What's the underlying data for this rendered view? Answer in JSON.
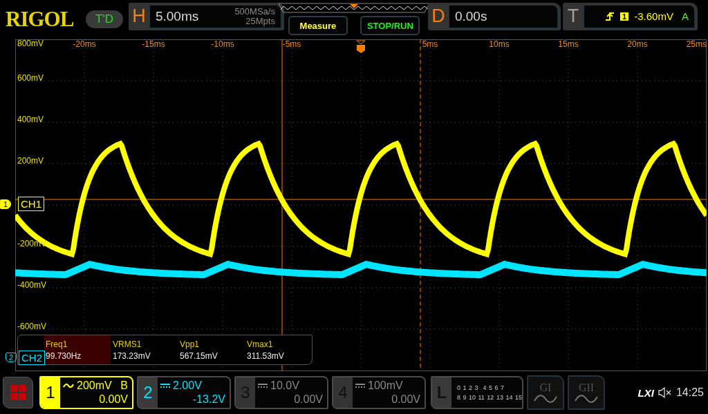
{
  "brand": "RIGOL",
  "trigger_status": "T'D",
  "horizontal": {
    "label": "H",
    "timebase": "5.00ms",
    "sample_rate": "500MSa/s",
    "memory_depth": "25Mpts"
  },
  "buttons": [
    {
      "label": "Measure",
      "kind": "measure"
    },
    {
      "label": "STOP/RUN",
      "kind": "run"
    }
  ],
  "delay": {
    "label": "D",
    "value": "0.00s"
  },
  "trigger": {
    "label": "T",
    "source": "1",
    "level": "-3.60mV",
    "mode": "A"
  },
  "x_axis_labels": [
    "-20ms",
    "-15ms",
    "-10ms",
    "-5ms",
    "5ms",
    "10ms",
    "15ms",
    "20ms",
    "25ms"
  ],
  "y_axis_labels": [
    "800mV",
    "600mV",
    "400mV",
    "200mV",
    "-200mV",
    "-400mV",
    "-600mV"
  ],
  "channel_markers": [
    {
      "number": "1",
      "label": "CH1",
      "color": "#ffff00"
    },
    {
      "number": "2",
      "label": "CH2",
      "color": "#00e5ff"
    }
  ],
  "measurements": [
    {
      "name": "Freq1",
      "value": "99.730Hz",
      "selected": true
    },
    {
      "name": "VRMS1",
      "value": "173.23mV",
      "selected": false
    },
    {
      "name": "Vpp1",
      "value": "567.15mV",
      "selected": false
    },
    {
      "name": "Vmax1",
      "value": "311.53mV",
      "selected": false
    }
  ],
  "channels": [
    {
      "number": "1",
      "scale": "200mV",
      "offset": "0.00V",
      "ac_coupled": true,
      "bandwidth_limit": "B",
      "selected": true,
      "enabled": true,
      "color": "#ffff00"
    },
    {
      "number": "2",
      "scale": "2.00V",
      "offset": "-13.2V",
      "ac_coupled": false,
      "selected": false,
      "enabled": true,
      "color": "#00e5ff"
    },
    {
      "number": "3",
      "scale": "10.0V",
      "offset": "0.00V",
      "ac_coupled": false,
      "selected": false,
      "enabled": false,
      "color": "#8a8a8a"
    },
    {
      "number": "4",
      "scale": "100mV",
      "offset": "0.00V",
      "ac_coupled": false,
      "selected": false,
      "enabled": false,
      "color": "#8a8a8a"
    }
  ],
  "logic": {
    "label": "L",
    "rows": [
      "0 1 2 3  4 5 6 7",
      "8 9 10 11 12 13 14 15"
    ]
  },
  "generators": [
    {
      "label": "GI"
    },
    {
      "label": "GII"
    }
  ],
  "status": {
    "lxi": "LXI",
    "muted": true,
    "time": "14:25"
  }
}
